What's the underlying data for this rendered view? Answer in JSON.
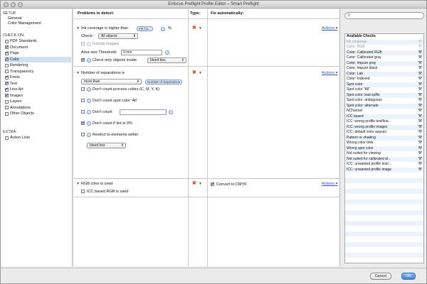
{
  "window": {
    "title": "Enfocus Preflight Profile Editor – Smart Preflight"
  },
  "sidebar": {
    "setup_heading": "SETUP",
    "setup_items": [
      "General",
      "Color Management"
    ],
    "checkon_heading": "CHECK ON:",
    "checkon_items": [
      {
        "label": "PDF Standards",
        "checked": false
      },
      {
        "label": "Document",
        "checked": true
      },
      {
        "label": "Page",
        "checked": true
      },
      {
        "label": "Color",
        "checked": true
      },
      {
        "label": "Rendering",
        "checked": false
      },
      {
        "label": "Transparency",
        "checked": false
      },
      {
        "label": "Fonts",
        "checked": true
      },
      {
        "label": "Text",
        "checked": true
      },
      {
        "label": "Line Art",
        "checked": true
      },
      {
        "label": "Images",
        "checked": true
      },
      {
        "label": "Layers",
        "checked": false
      },
      {
        "label": "Annotations",
        "checked": false
      },
      {
        "label": "Other Objects",
        "checked": false
      }
    ],
    "extra_heading": "EXTRA:",
    "extra_items": [
      {
        "label": "Action Lists",
        "checked": false
      }
    ]
  },
  "main": {
    "col_problems": "Problems to detect:",
    "col_type": "Type:",
    "col_fix": "Fix automatically:",
    "actions_label": "Actions",
    "ink": {
      "label": "Ink coverage is higher than",
      "token": "Ink Co...",
      "unit": "%",
      "check_label": "Check:",
      "check_value": "All objects",
      "include_images": "Include images",
      "area_label": "Area size Threshold:",
      "area_value": "0 mm",
      "inside_label": "Check only objects inside",
      "inside_value": "bleed box"
    },
    "seps": {
      "label": "Number of separations is",
      "compare_value": "more than",
      "token": "Number of Separations",
      "opt_process": "Don't count process colors (C, M, Y, K)",
      "opt_all": "Don't count spot color 'All'",
      "opt_count": "Don't count",
      "opt_tint": "Don't count if tint is 0%",
      "opt_restrict": "Restrict to elements within",
      "restrict_value": "bleed box"
    },
    "rgb": {
      "label": "RGB color is used",
      "icc_label": "ICC based RGB is used",
      "fix_label": "Convert to CMYK"
    }
  },
  "right": {
    "heading": "Available Checks",
    "items": [
      {
        "label": "Ink coverage",
        "grey": true
      },
      {
        "label": "Color: RGB",
        "grey": true
      },
      {
        "label": "Color: Calibrated RGB"
      },
      {
        "label": "Color: Calibrated gray"
      },
      {
        "label": "Color: Impure gray"
      },
      {
        "label": "Color: Impure black"
      },
      {
        "label": "Color: Lab"
      },
      {
        "label": "Color: Indexed"
      },
      {
        "label": "Spot color"
      },
      {
        "label": "Spot color \"All\""
      },
      {
        "label": "Spot color: bad suffix"
      },
      {
        "label": "Spot color: ambiguous"
      },
      {
        "label": "Spot color: alternate"
      },
      {
        "label": "NChannel"
      },
      {
        "label": "ICC based"
      },
      {
        "label": "ICC: wrong profile text/line..."
      },
      {
        "label": "ICC: wrong profile images"
      },
      {
        "label": "ICC: default color spaces"
      },
      {
        "label": "Pattern or shading"
      },
      {
        "label": "Wrong color tints"
      },
      {
        "label": "Wrong spot color"
      },
      {
        "label": "Not suited for viewing"
      },
      {
        "label": "Not suited for calibrated di..."
      },
      {
        "label": "ICC: unwanted profile text/..."
      },
      {
        "label": "ICC: unwanted profile image"
      }
    ]
  },
  "buttons": {
    "cancel": "Cancel",
    "ok": "OK"
  }
}
